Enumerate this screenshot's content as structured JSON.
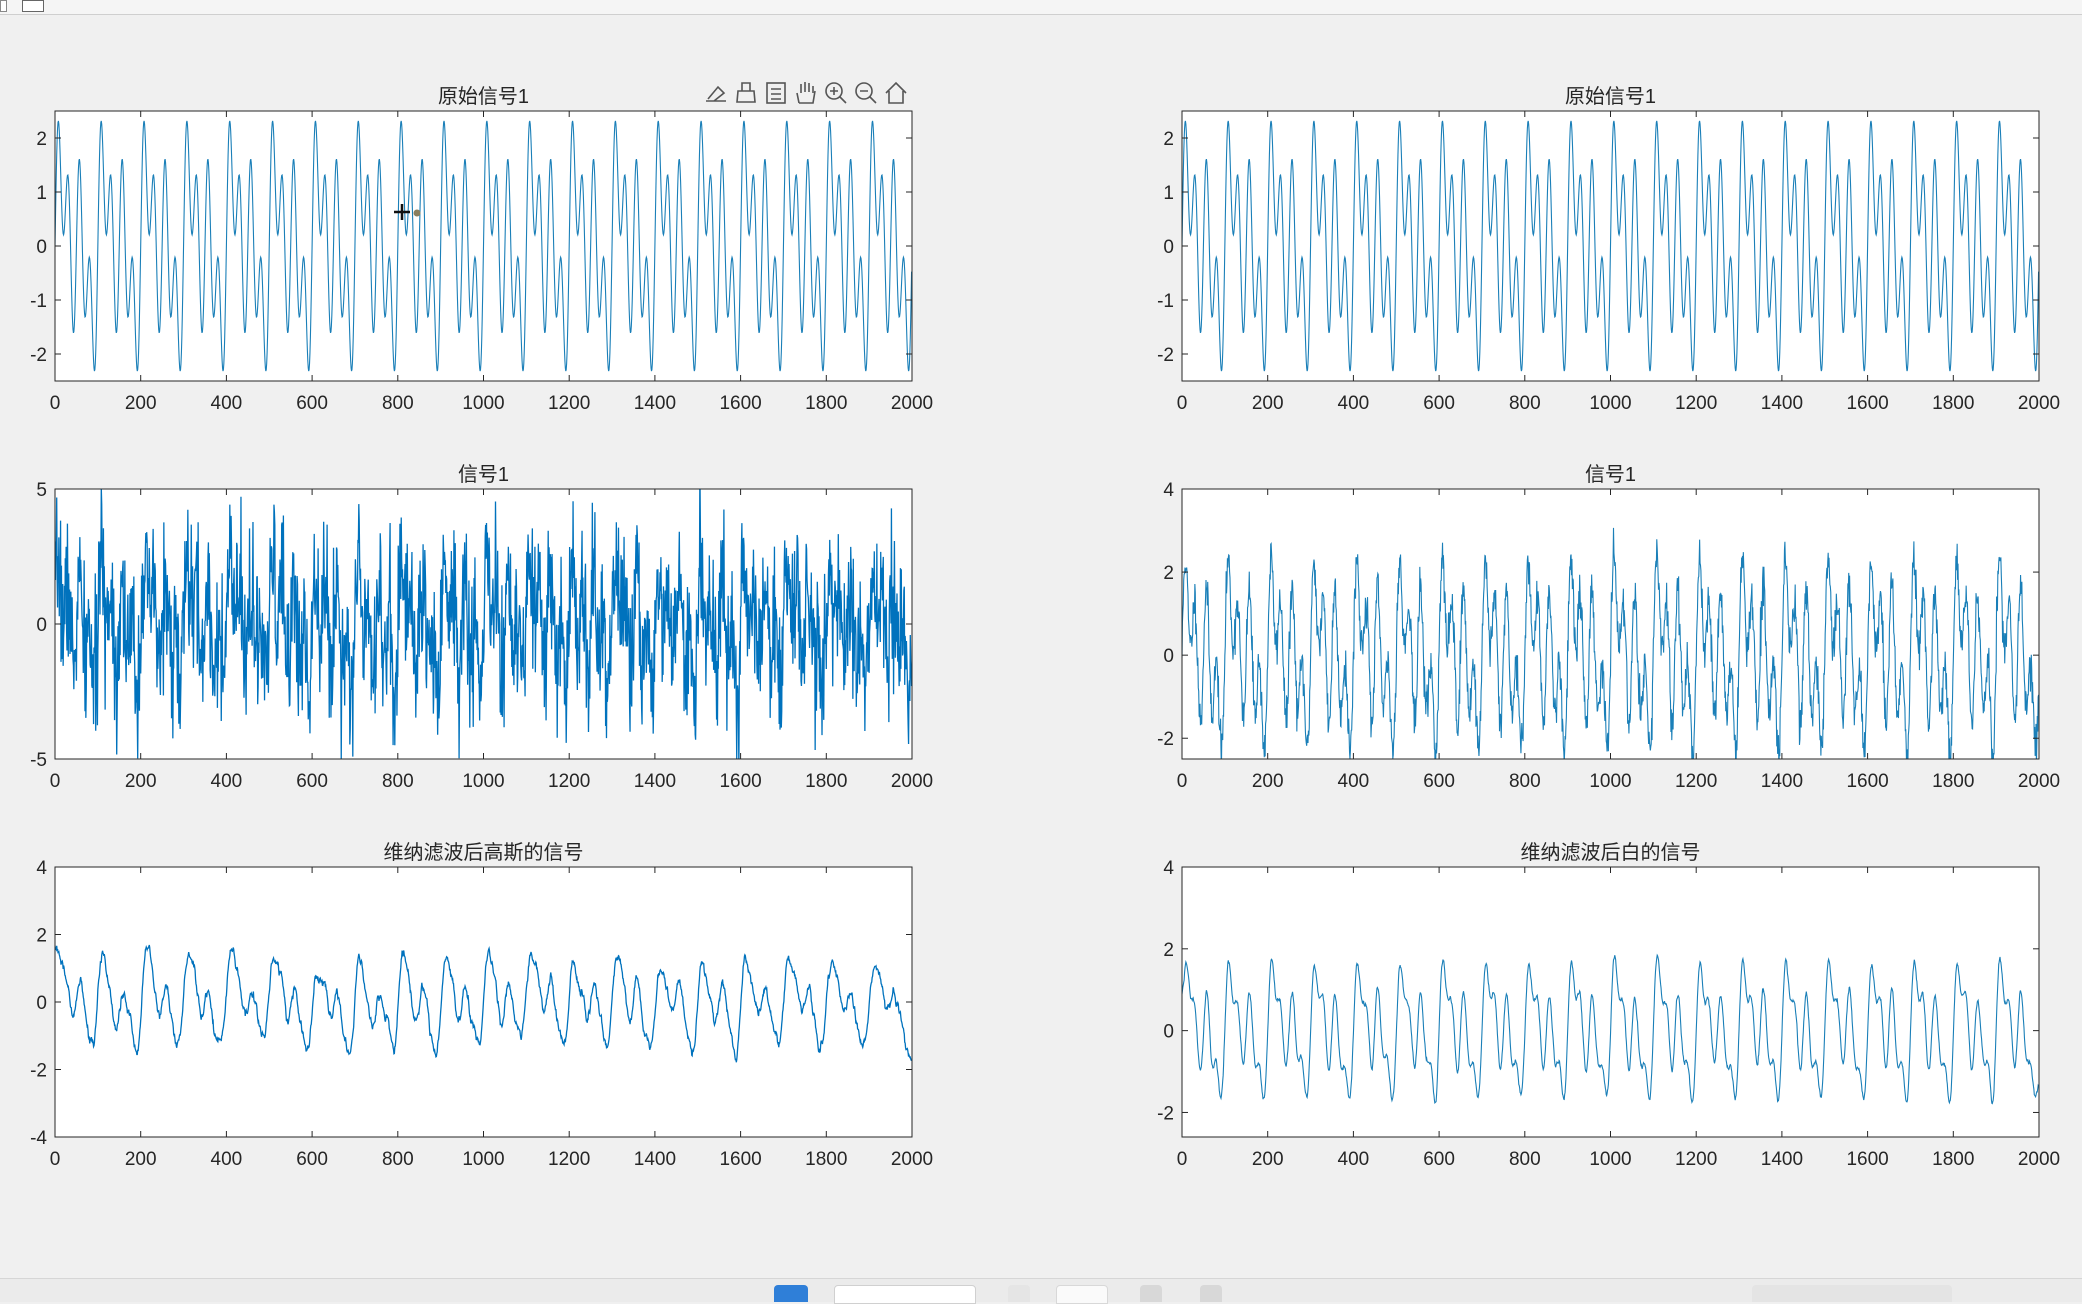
{
  "colors": {
    "figure_bg": "#f0f0f0",
    "axes_bg": "#ffffff",
    "axes_edge": "#262626",
    "line": "#0072bd",
    "line_thin": "#1a7fb8",
    "text": "#262626"
  },
  "toolbar": {
    "icons": [
      "data-tip-icon",
      "brush-icon",
      "legend-icon",
      "pan-hand-icon",
      "zoom-in-icon",
      "zoom-out-icon",
      "home-icon"
    ]
  },
  "chart_data": [
    {
      "type": "line",
      "title": "原始信号1",
      "xlim": [
        0,
        2000
      ],
      "ylim": [
        -2.5,
        2.5
      ],
      "xticks": [
        0,
        200,
        400,
        600,
        800,
        1000,
        1200,
        1400,
        1600,
        1800,
        2000
      ],
      "yticks": [
        -2,
        -1,
        0,
        1,
        2
      ],
      "series": [
        {
          "x_step": 1,
          "length": 2000,
          "components": [
            {
              "amp": 1.0,
              "period": 50
            },
            {
              "amp": 0.8,
              "period": 100
            },
            {
              "amp": 1.2,
              "period": 25
            }
          ],
          "noise": 0,
          "smooth": 0
        }
      ],
      "grid": false,
      "legend": "none"
    },
    {
      "type": "line",
      "title": "原始信号1",
      "xlim": [
        0,
        2000
      ],
      "ylim": [
        -2.5,
        2.5
      ],
      "xticks": [
        0,
        200,
        400,
        600,
        800,
        1000,
        1200,
        1400,
        1600,
        1800,
        2000
      ],
      "yticks": [
        -2,
        -1,
        0,
        1,
        2
      ],
      "series": [
        {
          "x_step": 1,
          "length": 2000,
          "components": [
            {
              "amp": 1.0,
              "period": 50
            },
            {
              "amp": 0.8,
              "period": 100
            },
            {
              "amp": 1.2,
              "period": 25
            }
          ],
          "noise": 0,
          "smooth": 0
        }
      ],
      "grid": false,
      "legend": "none"
    },
    {
      "type": "line",
      "title": "信号1",
      "xlim": [
        0,
        2000
      ],
      "ylim": [
        -5,
        5
      ],
      "xticks": [
        0,
        200,
        400,
        600,
        800,
        1000,
        1200,
        1400,
        1600,
        1800,
        2000
      ],
      "yticks": [
        -5,
        0,
        5
      ],
      "series": [
        {
          "x_step": 1,
          "length": 2000,
          "components": [
            {
              "amp": 1.0,
              "period": 50
            },
            {
              "amp": 0.8,
              "period": 100
            },
            {
              "amp": 1.2,
              "period": 25
            }
          ],
          "noise": 1.3,
          "smooth": 0,
          "seed": 7
        }
      ],
      "grid": false,
      "legend": "none"
    },
    {
      "type": "line",
      "title": "信号1",
      "xlim": [
        0,
        2000
      ],
      "ylim": [
        -2.5,
        4
      ],
      "xticks": [
        0,
        200,
        400,
        600,
        800,
        1000,
        1200,
        1400,
        1600,
        1800,
        2000
      ],
      "yticks": [
        -2,
        0,
        2,
        4
      ],
      "series": [
        {
          "x_step": 1,
          "length": 2000,
          "components": [
            {
              "amp": 1.0,
              "period": 50
            },
            {
              "amp": 0.8,
              "period": 100
            },
            {
              "amp": 1.2,
              "period": 25
            }
          ],
          "noise": 0.25,
          "smooth": 0,
          "seed": 11
        }
      ],
      "grid": false,
      "legend": "none"
    },
    {
      "type": "line",
      "title": "维纳滤波后高斯的信号",
      "xlim": [
        0,
        2000
      ],
      "ylim": [
        -4,
        4
      ],
      "xticks": [
        0,
        200,
        400,
        600,
        800,
        1000,
        1200,
        1400,
        1600,
        1800,
        2000
      ],
      "yticks": [
        -4,
        -2,
        0,
        2,
        4
      ],
      "series": [
        {
          "x_step": 1,
          "length": 2000,
          "components": [
            {
              "amp": 1.0,
              "period": 50
            },
            {
              "amp": 0.8,
              "period": 100
            },
            {
              "amp": 0.55,
              "period": 25
            }
          ],
          "noise": 0.9,
          "smooth": 9,
          "seed": 7
        }
      ],
      "grid": false,
      "legend": "none"
    },
    {
      "type": "line",
      "title": "维纳滤波后白的信号",
      "xlim": [
        0,
        2000
      ],
      "ylim": [
        -2.6,
        4
      ],
      "xticks": [
        0,
        200,
        400,
        600,
        800,
        1000,
        1200,
        1400,
        1600,
        1800,
        2000
      ],
      "yticks": [
        -2,
        0,
        2,
        4
      ],
      "series": [
        {
          "x_step": 1,
          "length": 2000,
          "components": [
            {
              "amp": 1.0,
              "period": 50
            },
            {
              "amp": 0.8,
              "period": 100
            },
            {
              "amp": 0.75,
              "period": 25
            }
          ],
          "noise": 0.25,
          "smooth": 5,
          "seed": 11
        }
      ],
      "grid": false,
      "legend": "none"
    }
  ]
}
